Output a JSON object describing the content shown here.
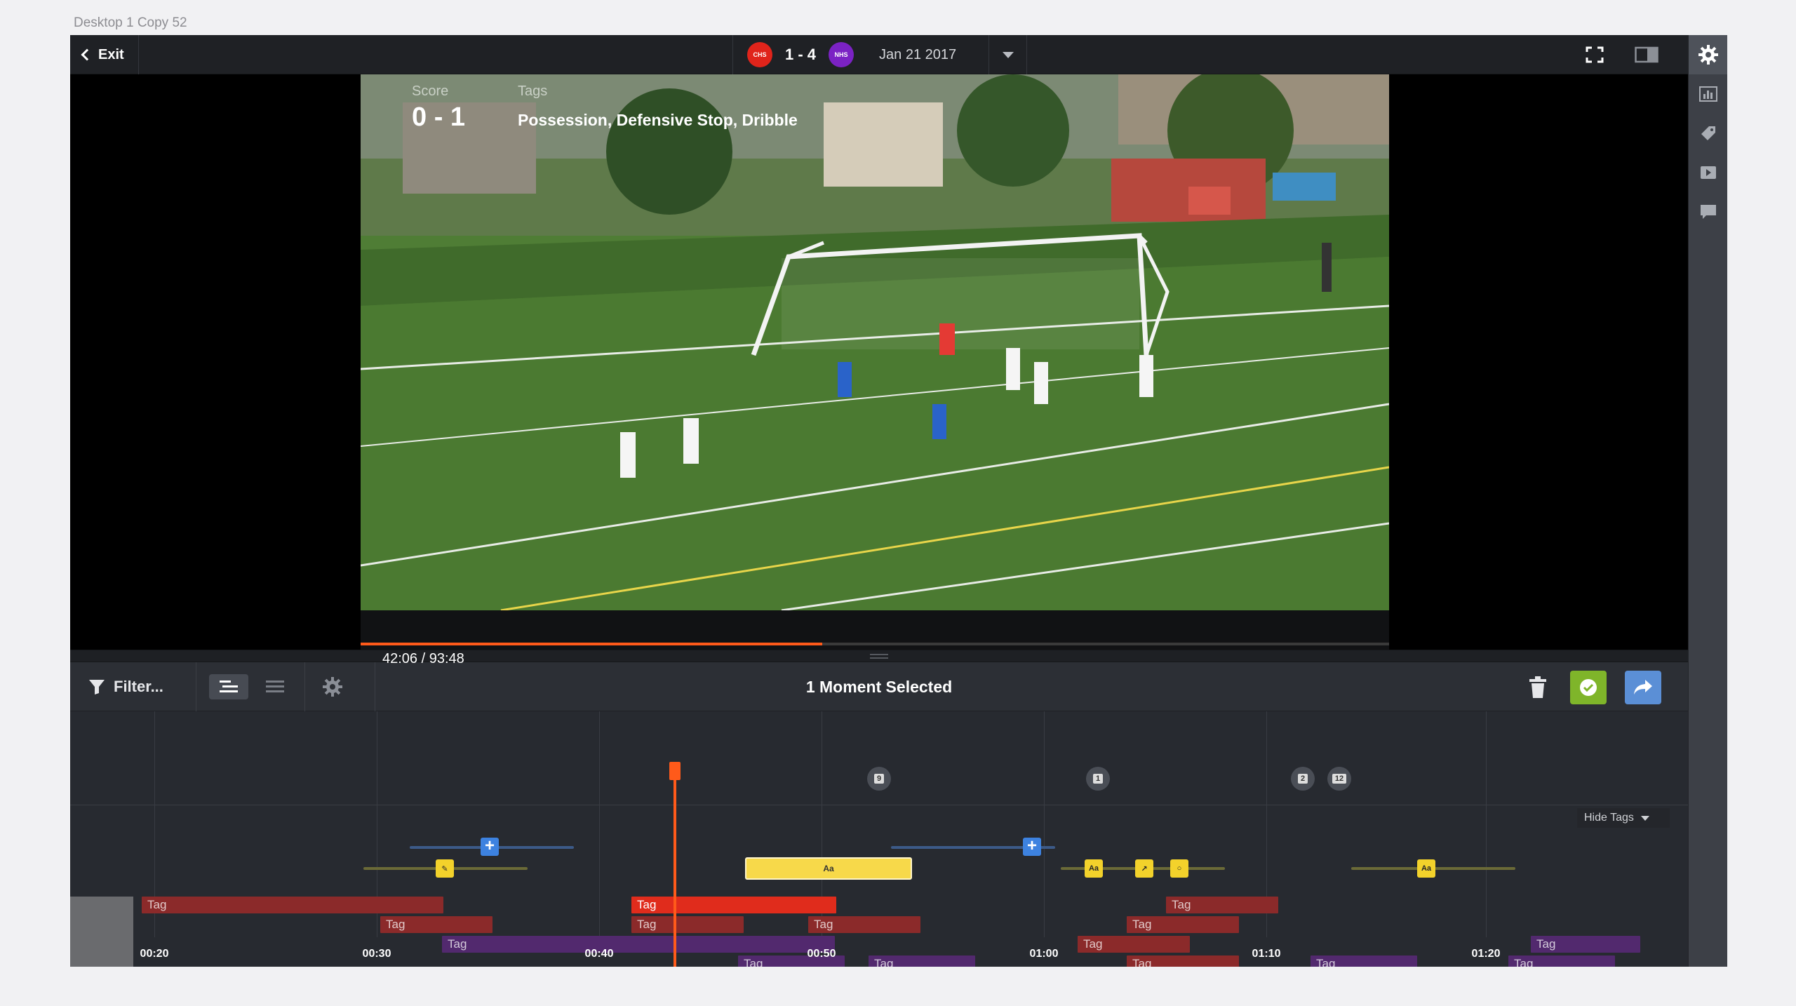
{
  "canvas_label": "Desktop 1 Copy 52",
  "topbar": {
    "exit_label": "Exit",
    "home_team": "CHS",
    "away_team": "NHS",
    "score": "1 - 4",
    "date": "Jan 21 2017"
  },
  "video": {
    "score_label": "Score",
    "score_value": "0 - 1",
    "tags_label": "Tags",
    "tags_value": "Possession, Defensive Stop, Dribble",
    "time": "42:06 / 93:48",
    "progress": 0.449
  },
  "toolbar": {
    "filter_label": "Filter...",
    "selection_title": "1 Moment Selected"
  },
  "timeline": {
    "ticks": [
      "00:20",
      "00:30",
      "00:40",
      "00:50",
      "01:00",
      "01:10",
      "01:20"
    ],
    "tag_label": "Tag",
    "hide_tags_label": "Hide Tags",
    "comments": [
      "9",
      "1",
      "2",
      "12"
    ],
    "marker_text": "Aa"
  },
  "colors": {
    "accent_orange": "#ff5a1a",
    "tag_red": "#8b2a2a",
    "tag_red_selected": "#e02c1c",
    "tag_purple": "#52296e",
    "confirm_green": "#7fb52a",
    "share_blue": "#5b8fd6",
    "marker_yellow": "#f3d22b"
  }
}
